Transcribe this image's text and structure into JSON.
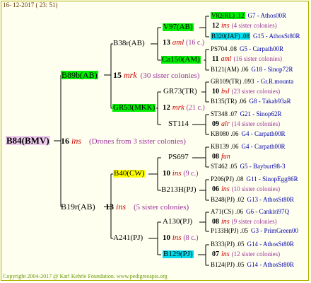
{
  "date": "16- 12-2017 ( 23: 51)",
  "footer": "Copyright 2004-2017 @ Karl Kehrle Foundation.   www.pedigreeapis.org",
  "root": {
    "name": "B84(BMV)",
    "num": "16",
    "abbr": "ins",
    "note": "(Drones from 3 sister colonies)"
  },
  "p1": {
    "name": "B89b(AB)",
    "num": "15",
    "abbr": "mrk",
    "note": "(30 sister colonies)"
  },
  "p2": {
    "name": "B19r(AB)",
    "num": "13",
    "abbr": "ins",
    "note": "(5 sister colonies)"
  },
  "g3": [
    {
      "name": "B38r(AB)",
      "num": "13",
      "abbr": "aml",
      "note": "(16 c.)"
    },
    {
      "name": "GR53(MKK)",
      "num": "12",
      "abbr": "mrk",
      "note": "(21 c.)"
    },
    {
      "name": "B40(CW)",
      "num": "10",
      "abbr": "ins",
      "note": "(9 c.)"
    },
    {
      "name": "A241(PJ)",
      "num": "10",
      "abbr": "ins",
      "note": "(8 c.)"
    }
  ],
  "g4": [
    {
      "name": "V97(AB)"
    },
    {
      "name": "Ca150(AM)"
    },
    {
      "name": "GR73(TR)"
    },
    {
      "name": "ST114"
    },
    {
      "name": "PS697"
    },
    {
      "name": "B213H(PJ)"
    },
    {
      "name": "A130(PJ)"
    },
    {
      "name": "B129(PJ)"
    }
  ],
  "g5": [
    {
      "name": "V82(RL) .12",
      "ref": "G7 - Athos00R",
      "num": "12",
      "abbr": "ins",
      "note": "(4 sister colonies)"
    },
    {
      "name": "B320(JAF) .08",
      "ref": "G15 - AthosSt80R"
    },
    {
      "name": "PS704 .08",
      "ref": "G5 - Carpath00R",
      "num": "11",
      "abbr": "aml",
      "note": "(16 sister colonies)"
    },
    {
      "name": "B121(AM) .06",
      "ref": "G18 - Sinop72R"
    },
    {
      "name": "GR109(TR) .093",
      "ref": "- Gr.R.mounta",
      "num": "10",
      "abbr": "bsl",
      "note": "(23 sister colonies)"
    },
    {
      "name": "B135(TR) .06",
      "ref": "G8 - Takab93aR"
    },
    {
      "name": "ST348 .07",
      "ref": "G21 - Sinop62R",
      "num": "09",
      "abbr": "alr",
      "note": "(14 sister colonies)"
    },
    {
      "name": "KB080 .06",
      "ref": "G4 - Carpath00R"
    },
    {
      "name": "KB139 .06",
      "ref": "G4 - Carpath00R",
      "num": "08",
      "abbr": "fun",
      "note": ""
    },
    {
      "name": "ST462 .05",
      "ref": "G5 - Bayburt98-3"
    },
    {
      "name": "P206(PJ) .08",
      "ref": "G11 - SinopEgg86R",
      "num": "06",
      "abbr": "ins",
      "note": "(10 sister colonies)"
    },
    {
      "name": "B248(PJ) .02",
      "ref": "G13 - AthosSt80R"
    },
    {
      "name": "A71(CS) .06",
      "ref": "G6 - Cankiri97Q",
      "num": "08",
      "abbr": "ins",
      "note": "(9 sister colonies)"
    },
    {
      "name": "P133H(PJ) .05",
      "ref": "G3 - PrimGreen00"
    },
    {
      "name": "B333(PJ) .05",
      "ref": "G14 - AthosSt80R",
      "num": "07",
      "abbr": "ins",
      "note": "(12 sister colonies)"
    },
    {
      "name": "B124(PJ) .05",
      "ref": "G14 - AthosSt80R"
    }
  ]
}
